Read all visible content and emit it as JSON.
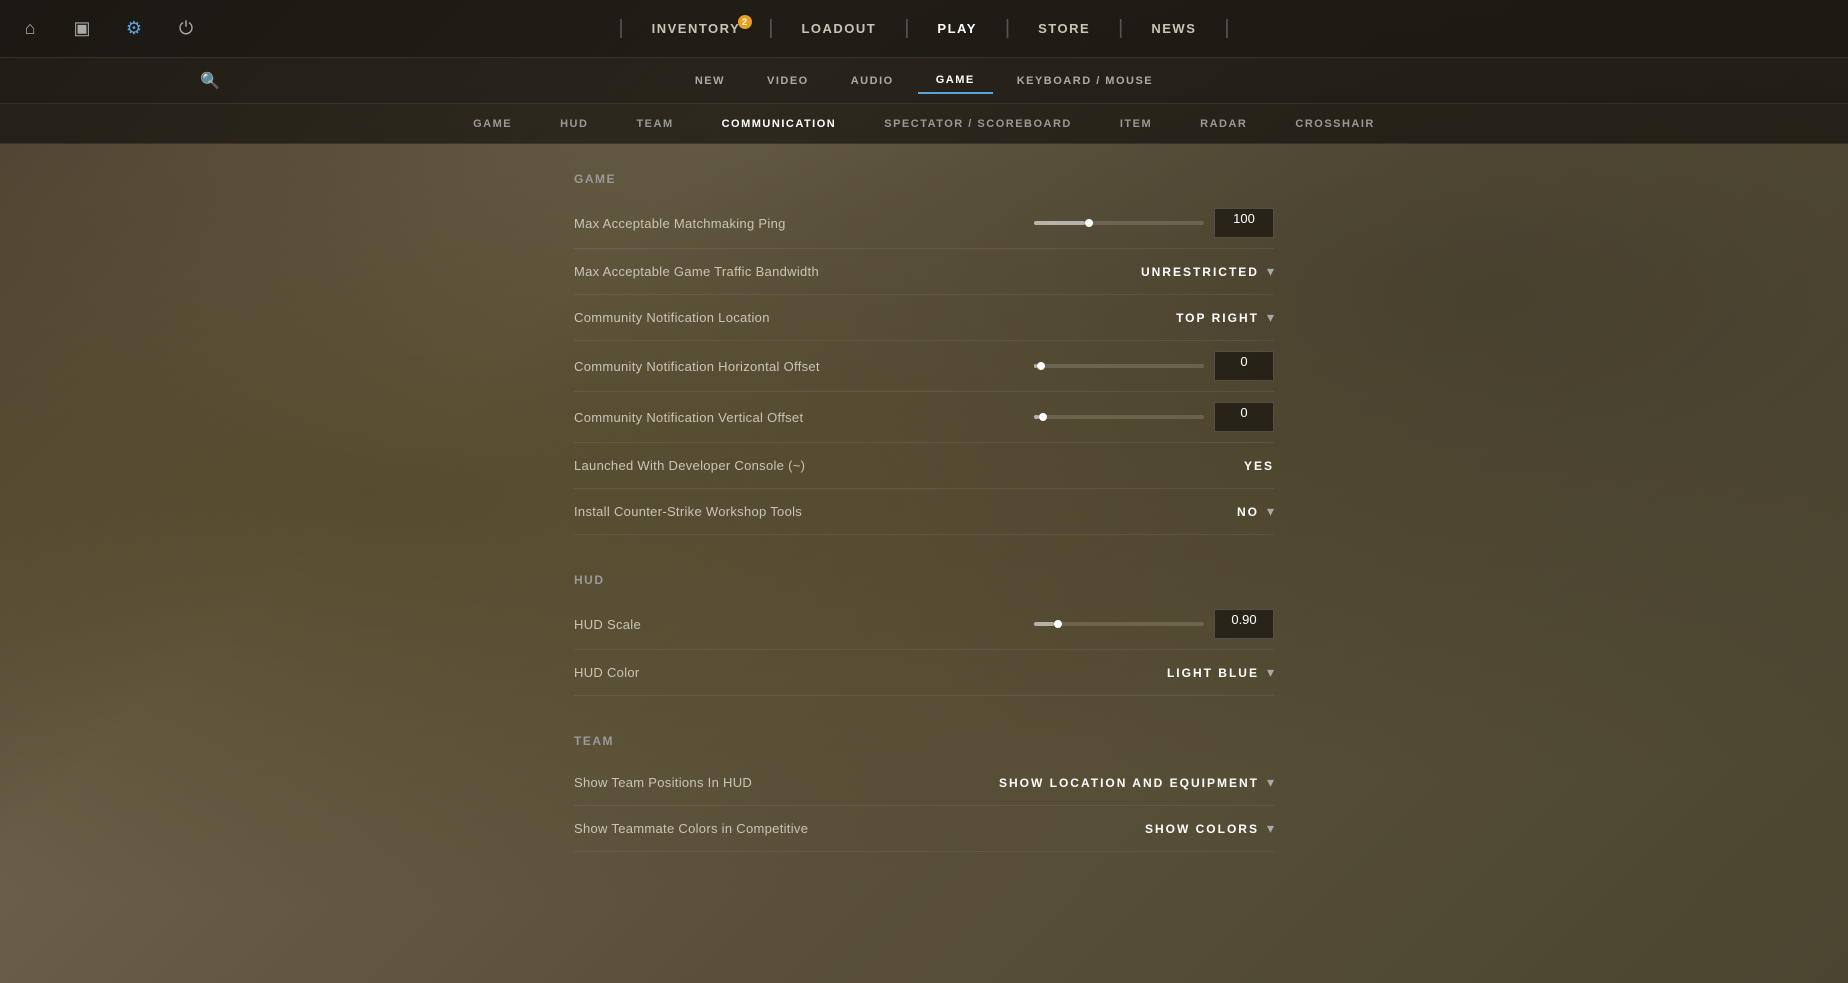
{
  "topbar": {
    "icons": [
      {
        "name": "home-icon",
        "symbol": "⌂",
        "active": false
      },
      {
        "name": "monitor-icon",
        "symbol": "▣",
        "active": false
      },
      {
        "name": "gear-icon",
        "symbol": "⚙",
        "active": true
      },
      {
        "name": "power-icon",
        "symbol": "⏻",
        "active": false
      }
    ],
    "nav": [
      {
        "id": "inventory",
        "label": "INVENTORY",
        "badge": "2",
        "active": false
      },
      {
        "id": "loadout",
        "label": "LOADOUT",
        "badge": null,
        "active": false
      },
      {
        "id": "play",
        "label": "PLAY",
        "badge": null,
        "active": false
      },
      {
        "id": "store",
        "label": "STORE",
        "badge": null,
        "active": false
      },
      {
        "id": "news",
        "label": "NEWS",
        "badge": null,
        "active": false
      }
    ]
  },
  "settings_tabs": {
    "search_icon": "🔍",
    "tabs": [
      {
        "id": "new",
        "label": "NEW",
        "active": false
      },
      {
        "id": "video",
        "label": "VIDEO",
        "active": false
      },
      {
        "id": "audio",
        "label": "AUDIO",
        "active": false
      },
      {
        "id": "game",
        "label": "GAME",
        "active": true
      },
      {
        "id": "keyboard-mouse",
        "label": "KEYBOARD / MOUSE",
        "active": false
      }
    ]
  },
  "game_subtabs": {
    "tabs": [
      {
        "id": "game",
        "label": "GAME",
        "active": false
      },
      {
        "id": "hud",
        "label": "HUD",
        "active": false
      },
      {
        "id": "team",
        "label": "TEAM",
        "active": false
      },
      {
        "id": "communication",
        "label": "COMMUNICATION",
        "active": true
      },
      {
        "id": "spectator-scoreboard",
        "label": "SPECTATOR / SCOREBOARD",
        "active": false
      },
      {
        "id": "item",
        "label": "ITEM",
        "active": false
      },
      {
        "id": "radar",
        "label": "RADAR",
        "active": false
      },
      {
        "id": "crosshair",
        "label": "CROSSHAIR",
        "active": false
      }
    ]
  },
  "sections": {
    "game": {
      "label": "Game",
      "settings": [
        {
          "id": "max-ping",
          "label": "Max Acceptable Matchmaking Ping",
          "type": "slider-input",
          "slider_fill_pct": 30,
          "slider_thumb_pct": 30,
          "value": "100"
        },
        {
          "id": "max-bandwidth",
          "label": "Max Acceptable Game Traffic Bandwidth",
          "type": "dropdown",
          "value": "UNRESTRICTED"
        },
        {
          "id": "notification-location",
          "label": "Community Notification Location",
          "type": "dropdown",
          "value": "TOP RIGHT"
        },
        {
          "id": "notification-h-offset",
          "label": "Community Notification Horizontal Offset",
          "type": "slider-input",
          "slider_fill_pct": 2,
          "slider_thumb_pct": 2,
          "value": "0"
        },
        {
          "id": "notification-v-offset",
          "label": "Community Notification Vertical Offset",
          "type": "slider-input",
          "slider_fill_pct": 3,
          "slider_thumb_pct": 3,
          "value": "0"
        },
        {
          "id": "developer-console",
          "label": "Launched With Developer Console (~)",
          "type": "static",
          "value": "YES"
        },
        {
          "id": "workshop-tools",
          "label": "Install Counter-Strike Workshop Tools",
          "type": "dropdown",
          "value": "NO"
        }
      ]
    },
    "hud": {
      "label": "Hud",
      "settings": [
        {
          "id": "hud-scale",
          "label": "HUD Scale",
          "type": "slider-input",
          "slider_fill_pct": 12,
          "slider_thumb_pct": 12,
          "value": "0.90"
        },
        {
          "id": "hud-color",
          "label": "HUD Color",
          "type": "dropdown",
          "value": "LIGHT BLUE"
        }
      ]
    },
    "team": {
      "label": "Team",
      "settings": [
        {
          "id": "show-team-positions",
          "label": "Show Team Positions In HUD",
          "type": "dropdown",
          "value": "SHOW LOCATION AND EQUIPMENT"
        },
        {
          "id": "teammate-colors",
          "label": "Show Teammate Colors in Competitive",
          "type": "dropdown",
          "value": "SHOW COLORS"
        }
      ]
    }
  }
}
